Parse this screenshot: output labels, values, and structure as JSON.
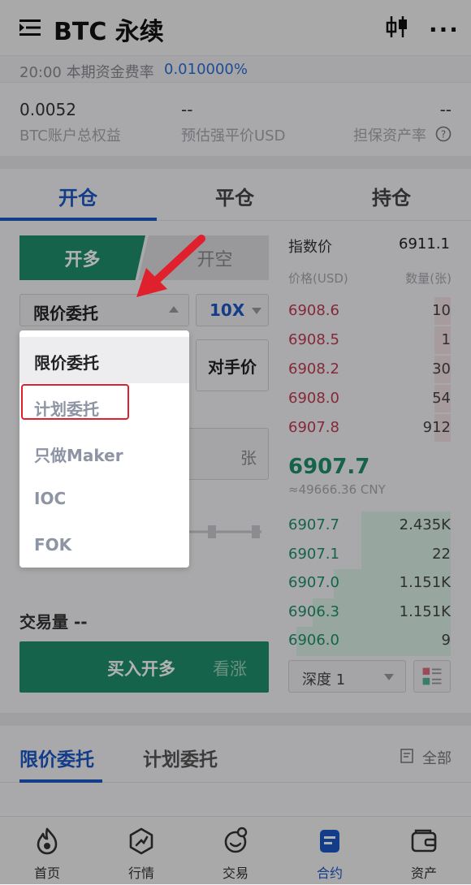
{
  "header": {
    "title": "BTC 永续",
    "menu_icon": "list-icon",
    "chart_icon": "candlestick-icon",
    "more_icon": "more-icon",
    "more_glyph": "···"
  },
  "funding": {
    "label": "20:00 本期资金费率",
    "value": "0.010000%"
  },
  "stats": [
    {
      "value": "0.0052",
      "label": "BTC账户总权益"
    },
    {
      "value": "--",
      "label": "预估强平价USD"
    },
    {
      "value": "--",
      "label": "担保资产率"
    }
  ],
  "tabs": [
    "开仓",
    "平仓",
    "持仓"
  ],
  "trade": {
    "long_label": "开多",
    "short_label": "开空",
    "order_type": "限价委托",
    "leverage": "10X",
    "counterparty_label": "对手价",
    "qty_unit": "张",
    "volume_label": "交易量 --",
    "buy_label": "买入开多",
    "buy_sub": "看涨"
  },
  "dropdown": {
    "items": [
      "限价委托",
      "计划委托",
      "只做Maker",
      "IOC",
      "FOK"
    ],
    "selected": "限价委托",
    "highlighted": "计划委托"
  },
  "orderbook": {
    "index_label": "指数价",
    "index_value": "6911.1",
    "price_header": "价格(USD)",
    "qty_header": "数量(张)",
    "asks": [
      {
        "price": "6908.6",
        "qty": "10",
        "depth": 0.1
      },
      {
        "price": "6908.5",
        "qty": "1",
        "depth": 0.1
      },
      {
        "price": "6908.2",
        "qty": "30",
        "depth": 0.1
      },
      {
        "price": "6908.0",
        "qty": "54",
        "depth": 0.1
      },
      {
        "price": "6907.8",
        "qty": "912",
        "depth": 0.1
      }
    ],
    "last_price": "6907.7",
    "last_cny": "≈49666.36 CNY",
    "bids": [
      {
        "price": "6907.7",
        "qty": "2.435K",
        "depth": 0.55
      },
      {
        "price": "6907.1",
        "qty": "22",
        "depth": 0.55
      },
      {
        "price": "6907.0",
        "qty": "1.151K",
        "depth": 0.72
      },
      {
        "price": "6906.3",
        "qty": "1.151K",
        "depth": 0.85
      },
      {
        "price": "6906.0",
        "qty": "9",
        "depth": 0.95
      }
    ],
    "depth_select": "深度 1",
    "layout_icon": "layout-icon"
  },
  "orders_tabs": {
    "active": "限价委托",
    "other": "计划委托",
    "all_label": "全部"
  },
  "bottom_nav": [
    {
      "label": "首页",
      "icon": "home-flame-icon"
    },
    {
      "label": "行情",
      "icon": "market-icon"
    },
    {
      "label": "交易",
      "icon": "trade-icon"
    },
    {
      "label": "合约",
      "icon": "contract-icon",
      "active": true
    },
    {
      "label": "资产",
      "icon": "wallet-icon"
    }
  ],
  "colors": {
    "brand": "#1c58c4",
    "buy": "#1f8f6a",
    "sell": "#bf3a52",
    "highlight": "#e0202c"
  }
}
